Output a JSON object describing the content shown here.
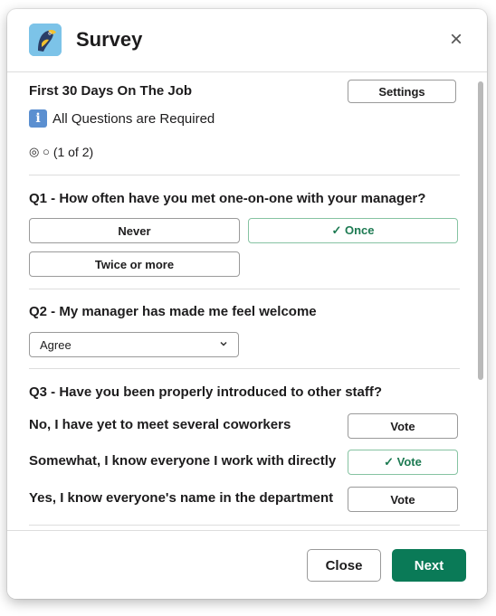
{
  "header": {
    "title": "Survey",
    "app_icon": "bird-logo-icon",
    "close_icon": "close-icon",
    "close_glyph": "×"
  },
  "survey": {
    "name": "First 30 Days On The Job",
    "settings_label": "Settings",
    "info_text": "All Questions are Required",
    "info_glyph": "i",
    "progress_glyphs": "◎ ○",
    "progress_text": "(1 of 2)"
  },
  "q1": {
    "title": "Q1 - How often have you met one-on-one with your manager?",
    "options": [
      {
        "label": "Never",
        "selected": false
      },
      {
        "label": "✓ Once",
        "selected": true
      },
      {
        "label": "Twice or more",
        "selected": false
      }
    ]
  },
  "q2": {
    "title": "Q2 - My manager has made me feel welcome",
    "selected_value": "Agree"
  },
  "q3": {
    "title": "Q3 - Have you been properly introduced to other staff?",
    "options": [
      {
        "label": "No, I have yet to meet several coworkers",
        "vote_label": "Vote",
        "selected": false
      },
      {
        "label": "Somewhat, I know everyone I work with directly",
        "vote_label": "✓ Vote",
        "selected": true
      },
      {
        "label": "Yes, I know everyone's name in the department",
        "vote_label": "Vote",
        "selected": false
      }
    ]
  },
  "footer": {
    "close_label": "Close",
    "next_label": "Next"
  },
  "colors": {
    "accent_green": "#0a7a57",
    "selected_green": "#1d7a52",
    "info_blue": "#5b8fd0"
  }
}
